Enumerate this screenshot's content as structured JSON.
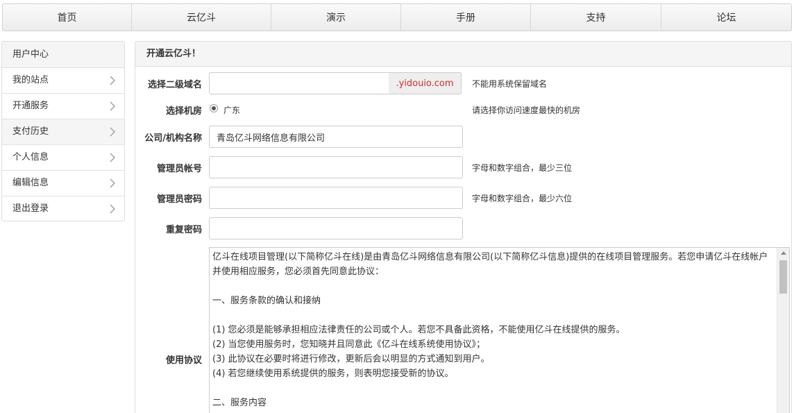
{
  "nav": {
    "items": [
      {
        "label": "首页"
      },
      {
        "label": "云亿斗"
      },
      {
        "label": "演示"
      },
      {
        "label": "手册"
      },
      {
        "label": "支持"
      },
      {
        "label": "论坛"
      }
    ]
  },
  "sidebar": {
    "header": "用户中心",
    "items": [
      {
        "label": "我的站点"
      },
      {
        "label": "开通服务"
      },
      {
        "label": "支付历史"
      },
      {
        "label": "个人信息"
      },
      {
        "label": "编辑信息"
      },
      {
        "label": "退出登录"
      }
    ]
  },
  "form": {
    "title": "开通云亿斗！",
    "subdomain": {
      "label": "选择二级域名",
      "value": "",
      "suffix": ".yidouio.com",
      "hint": "不能用系统保留域名"
    },
    "datacenter": {
      "label": "选择机房",
      "option": "广东",
      "hint": "请选择你访问速度最快的机房"
    },
    "company": {
      "label": "公司/机构名称",
      "value": "青岛亿斗网络信息有限公司"
    },
    "admin_account": {
      "label": "管理员帐号",
      "value": "",
      "hint": "字母和数字组合，最少三位"
    },
    "admin_password": {
      "label": "管理员密码",
      "value": "",
      "hint": "字母和数字组合，最少六位"
    },
    "repeat_password": {
      "label": "重复密码",
      "value": ""
    },
    "agreement": {
      "label": "使用协议",
      "lines": [
        "亿斗在线项目管理(以下简称亿斗在线)是由青岛亿斗网络信息有限公司(以下简称亿斗信息)提供的在线项目管理服务。若您申请亿斗在线帐户并使用相应服务，您必须首先同意此协议：",
        "",
        "一、服务条款的确认和接纳",
        "",
        "(1) 您必须是能够承担相应法律责任的公司或个人。若您不具备此资格，不能使用亿斗在线提供的服务。",
        "(2) 当您使用服务时，您知晓并且同意此《亿斗在线系统使用协议》；",
        "(3) 此协议在必要时将进行修改，更新后会以明显的方式通知到用户。",
        "(4) 若您继续使用系统提供的服务，则表明您接受新的协议。",
        "",
        "二、服务内容"
      ]
    }
  },
  "colors": {
    "accent_red": "#c9302c",
    "border": "#dddddd",
    "header_bg": "#f5f5f5"
  }
}
